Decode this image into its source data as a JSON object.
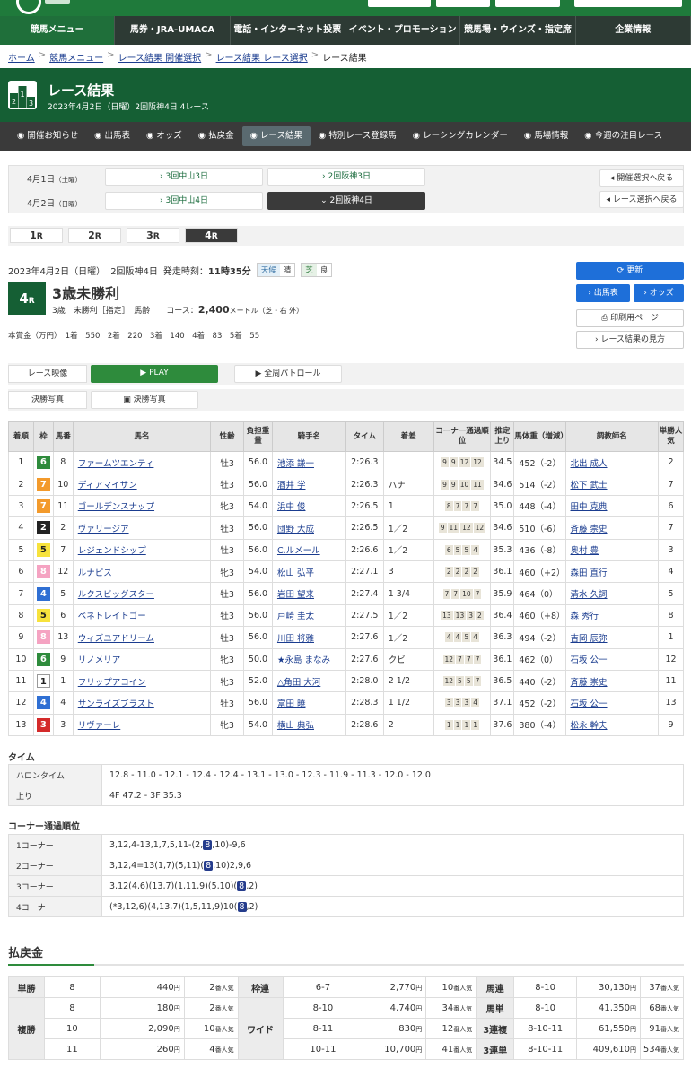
{
  "nav": [
    "競馬メニュー",
    "馬券・JRA-UMACA",
    "電話・インターネット投票",
    "イベント・プロモーション",
    "競馬場・ウインズ・指定席",
    "企業情報"
  ],
  "breadcrumb": [
    "ホーム",
    "競馬メニュー",
    "レース結果 開催選択",
    "レース結果 レース選択",
    "レース結果"
  ],
  "header": {
    "title": "レース結果",
    "subtitle": "2023年4月2日（日曜）2回阪神4日 4レース"
  },
  "subnav": [
    "開催お知らせ",
    "出馬表",
    "オッズ",
    "払戻金",
    "レース結果",
    "特別レース登録馬",
    "レーシングカレンダー",
    "馬場情報",
    "今週の注目レース"
  ],
  "dates": [
    {
      "date": "4月1日",
      "dow": "（土曜）",
      "kaisai": [
        "3回中山3日",
        "2回阪神3日"
      ]
    },
    {
      "date": "4月2日",
      "dow": "（日曜）",
      "kaisai": [
        "3回中山4日",
        "2回阪神4日"
      ]
    }
  ],
  "side_buttons": [
    "開催選択へ戻る",
    "レース選択へ戻る"
  ],
  "race_tabs": [
    "1",
    "2",
    "3",
    "4"
  ],
  "race_tab_suffix": "R",
  "info": {
    "date": "2023年4月2日（日曜）",
    "meeting": "2回阪神4日",
    "start_label": "発走時刻：",
    "start_time": "11時35分",
    "weather_label": "天候",
    "weather": "晴",
    "track_label": "芝",
    "condition": "良"
  },
  "race": {
    "num": "4",
    "suffix": "R",
    "name": "3歳未勝利",
    "cond": "3歳　未勝利［指定］　馬齢",
    "course_label": "コース：",
    "distance": "2,400",
    "unit": "メートル（芝・右 外）"
  },
  "prize": "本賞金（万円）　1着　550　2着　220　3着　140　4着　83　5着　55",
  "right_buttons": {
    "update": "更新",
    "shutuba": "出馬表",
    "odds": "オッズ",
    "print": "印刷用ページ",
    "howto": "レース結果の見方"
  },
  "video": {
    "label1": "レース映像",
    "play": "PLAY",
    "patrol": "全周パトロール",
    "label2": "決勝写真",
    "photo": "決勝写真"
  },
  "table_headers": [
    "着順",
    "枠",
    "馬番",
    "馬名",
    "性齢",
    "負担重量",
    "騎手名",
    "タイム",
    "着差",
    "コーナー通過順位",
    "推定上り",
    "馬体重（増減）",
    "調教師名",
    "単勝人気"
  ],
  "results": [
    {
      "rank": "1",
      "waku": "6",
      "num": "8",
      "horse": "ファームツエンティ",
      "sex": "牡3",
      "wt": "56.0",
      "jockey": "池添 謙一",
      "time": "2:26.3",
      "margin": "",
      "corner": [
        "9",
        "9",
        "12",
        "12"
      ],
      "last": "34.5",
      "bw": "452（-2）",
      "trainer": "北出 成人",
      "pop": "2"
    },
    {
      "rank": "2",
      "waku": "7",
      "num": "10",
      "horse": "ディアマイサン",
      "sex": "牡3",
      "wt": "56.0",
      "jockey": "酒井 学",
      "time": "2:26.3",
      "margin": "ハナ",
      "corner": [
        "9",
        "9",
        "10",
        "11"
      ],
      "last": "34.6",
      "bw": "514（-2）",
      "trainer": "松下 武士",
      "pop": "7"
    },
    {
      "rank": "3",
      "waku": "7",
      "num": "11",
      "horse": "ゴールデンスナップ",
      "sex": "牝3",
      "wt": "54.0",
      "jockey": "浜中 俊",
      "time": "2:26.5",
      "margin": "1",
      "corner": [
        "8",
        "7",
        "7",
        "7"
      ],
      "last": "35.0",
      "bw": "448（-4）",
      "trainer": "田中 克典",
      "pop": "6"
    },
    {
      "rank": "4",
      "waku": "2",
      "num": "2",
      "horse": "ヴァリージア",
      "sex": "牡3",
      "wt": "56.0",
      "jockey": "団野 大成",
      "time": "2:26.5",
      "margin": "1／2",
      "corner": [
        "9",
        "11",
        "12",
        "12"
      ],
      "last": "34.6",
      "bw": "510（-6）",
      "trainer": "斉藤 崇史",
      "pop": "7"
    },
    {
      "rank": "5",
      "waku": "5",
      "num": "7",
      "horse": "レジェンドシップ",
      "sex": "牡3",
      "wt": "56.0",
      "jockey": "C.ルメール",
      "time": "2:26.6",
      "margin": "1／2",
      "corner": [
        "6",
        "5",
        "5",
        "4"
      ],
      "last": "35.3",
      "bw": "436（-8）",
      "trainer": "奥村 豊",
      "pop": "3"
    },
    {
      "rank": "6",
      "waku": "8",
      "num": "12",
      "horse": "ルナピス",
      "sex": "牝3",
      "wt": "54.0",
      "jockey": "松山 弘平",
      "time": "2:27.1",
      "margin": "3",
      "corner": [
        "2",
        "2",
        "2",
        "2"
      ],
      "last": "36.1",
      "bw": "460（+2）",
      "trainer": "森田 直行",
      "pop": "4"
    },
    {
      "rank": "7",
      "waku": "4",
      "num": "5",
      "horse": "ルクスビッグスター",
      "sex": "牡3",
      "wt": "56.0",
      "jockey": "岩田 望来",
      "time": "2:27.4",
      "margin": "1 3/4",
      "corner": [
        "7",
        "7",
        "10",
        "7"
      ],
      "last": "35.9",
      "bw": "464（0）",
      "trainer": "清水 久詞",
      "pop": "5"
    },
    {
      "rank": "8",
      "waku": "5",
      "num": "6",
      "horse": "ベネトレイトゴー",
      "sex": "牡3",
      "wt": "56.0",
      "jockey": "戸崎 圭太",
      "time": "2:27.5",
      "margin": "1／2",
      "corner": [
        "13",
        "13",
        "3",
        "2"
      ],
      "last": "36.4",
      "bw": "460（+8）",
      "trainer": "森 秀行",
      "pop": "8"
    },
    {
      "rank": "9",
      "waku": "8",
      "num": "13",
      "horse": "ウィズユアドリーム",
      "sex": "牡3",
      "wt": "56.0",
      "jockey": "川田 将雅",
      "time": "2:27.6",
      "margin": "1／2",
      "corner": [
        "4",
        "4",
        "5",
        "4"
      ],
      "last": "36.3",
      "bw": "494（-2）",
      "trainer": "吉岡 辰弥",
      "pop": "1"
    },
    {
      "rank": "10",
      "waku": "6",
      "num": "9",
      "horse": "リノメリア",
      "sex": "牝3",
      "wt": "50.0",
      "jockey": "★永島 まなみ",
      "time": "2:27.6",
      "margin": "クビ",
      "corner": [
        "12",
        "7",
        "7",
        "7"
      ],
      "last": "36.1",
      "bw": "462（0）",
      "trainer": "石坂 公一",
      "pop": "12"
    },
    {
      "rank": "11",
      "waku": "1",
      "num": "1",
      "horse": "フリップアコイン",
      "sex": "牝3",
      "wt": "52.0",
      "jockey": "△角田 大河",
      "time": "2:28.0",
      "margin": "2 1/2",
      "corner": [
        "12",
        "5",
        "5",
        "7"
      ],
      "last": "36.5",
      "bw": "440（-2）",
      "trainer": "斉藤 崇史",
      "pop": "11"
    },
    {
      "rank": "12",
      "waku": "4",
      "num": "4",
      "horse": "サンライズブラスト",
      "sex": "牡3",
      "wt": "56.0",
      "jockey": "富田 暁",
      "time": "2:28.3",
      "margin": "1 1/2",
      "corner": [
        "3",
        "3",
        "3",
        "4"
      ],
      "last": "37.1",
      "bw": "452（-2）",
      "trainer": "石坂 公一",
      "pop": "13"
    },
    {
      "rank": "13",
      "waku": "3",
      "num": "3",
      "horse": "リヴァーレ",
      "sex": "牝3",
      "wt": "54.0",
      "jockey": "横山 典弘",
      "time": "2:28.6",
      "margin": "2",
      "corner": [
        "1",
        "1",
        "1",
        "1"
      ],
      "last": "37.6",
      "bw": "380（-4）",
      "trainer": "松永 幹夫",
      "pop": "9"
    }
  ],
  "waku_colors": {
    "1": "#ffffff",
    "2": "#222222",
    "3": "#d42a2a",
    "4": "#2f6fd3",
    "5": "#f7e23c",
    "6": "#2e8b3c",
    "7": "#f39a2b",
    "8": "#f5a3c2"
  },
  "time_section": {
    "title": "タイム",
    "rows": [
      {
        "k": "ハロンタイム",
        "v": "12.8 - 11.0 - 12.1 - 12.4 - 12.4 - 13.1 - 13.0 - 12.3 - 11.9 - 11.3 - 12.0 - 12.0"
      },
      {
        "k": "上り",
        "v": "4F 47.2 - 3F 35.3"
      }
    ]
  },
  "corner_section": {
    "title": "コーナー通過順位",
    "rows": [
      {
        "k": "1コーナー",
        "pre": "3,12,4-13,1,7,5,11-(2,",
        "hl": "8",
        "post": ",10)-9,6"
      },
      {
        "k": "2コーナー",
        "pre": "3,12,4=13(1,7)(5,11)(",
        "hl": "8",
        "post": ",10)2,9,6"
      },
      {
        "k": "3コーナー",
        "pre": "3,12(4,6)(13,7)(1,11,9)(5,10)(",
        "hl": "8",
        "post": ",2)"
      },
      {
        "k": "4コーナー",
        "pre": "(*3,12,6)(4,13,7)(1,5,11,9)10(",
        "hl": "8",
        "post": ",2)"
      }
    ]
  },
  "payout_title": "払戻金",
  "payout": {
    "yen": "円",
    "nin": "番人気",
    "tansho": {
      "label": "単勝",
      "rows": [
        [
          "8",
          "440",
          "2"
        ]
      ]
    },
    "fukusho": {
      "label": "複勝",
      "rows": [
        [
          "8",
          "180",
          "2"
        ],
        [
          "10",
          "2,090",
          "10"
        ],
        [
          "11",
          "260",
          "4"
        ]
      ]
    },
    "wakuren": {
      "label": "枠連",
      "rows": [
        [
          "6-7",
          "2,770",
          "10"
        ]
      ]
    },
    "wide": {
      "label": "ワイド",
      "rows": [
        [
          "8-10",
          "4,740",
          "34"
        ],
        [
          "8-11",
          "830",
          "12"
        ],
        [
          "10-11",
          "10,700",
          "41"
        ]
      ]
    },
    "umaren": {
      "label": "馬連",
      "rows": [
        [
          "8-10",
          "30,130",
          "37"
        ]
      ]
    },
    "umatan": {
      "label": "馬単",
      "rows": [
        [
          "8-10",
          "41,350",
          "68"
        ]
      ]
    },
    "trio": {
      "label": "3連複",
      "rows": [
        [
          "8-10-11",
          "61,550",
          "91"
        ]
      ]
    },
    "trifecta": {
      "label": "3連単",
      "rows": [
        [
          "8-10-11",
          "409,610",
          "534"
        ]
      ]
    }
  }
}
